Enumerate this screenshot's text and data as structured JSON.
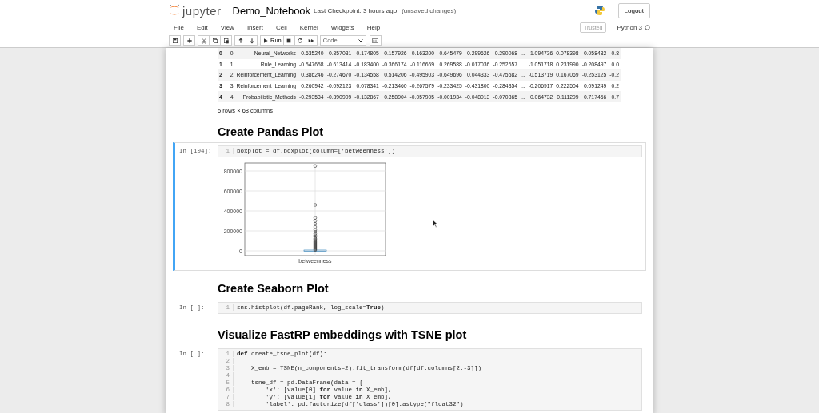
{
  "header": {
    "logo_text": "jupyter",
    "notebook_name": "Demo_Notebook",
    "checkpoint": "Last Checkpoint: 3 hours ago",
    "unsaved": "(unsaved changes)",
    "logout": "Logout"
  },
  "menu": [
    "File",
    "Edit",
    "View",
    "Insert",
    "Cell",
    "Kernel",
    "Widgets",
    "Help"
  ],
  "toolbar": {
    "run_label": "Run",
    "cell_type": "Code",
    "trusted": "Trusted",
    "kernel": "Python 3"
  },
  "cells": [
    {
      "kind": "table",
      "rows": [
        {
          "index": "0",
          "cells": [
            "0",
            "Neural_Networks",
            "-0.635240",
            "0.357031",
            "0.174805",
            "-0.157926",
            "0.163200",
            "-0.645479",
            "0.299626",
            "0.290068",
            "...",
            "1.094736",
            "0.078398",
            "0.058482",
            "-0.8"
          ]
        },
        {
          "index": "1",
          "cells": [
            "1",
            "Rule_Learning",
            "-0.547658",
            "-0.613414",
            "-0.183400",
            "-0.366174",
            "-0.116669",
            "0.269588",
            "-0.017036",
            "-0.252657",
            "...",
            "-1.051718",
            "0.231990",
            "-0.208497",
            "0.0"
          ]
        },
        {
          "index": "2",
          "cells": [
            "2",
            "Reinforcement_Learning",
            "0.386246",
            "-0.274670",
            "-0.134558",
            "0.514206",
            "-0.495903",
            "-0.649696",
            "0.044333",
            "-0.475582",
            "...",
            "-0.513719",
            "0.167069",
            "-0.253125",
            "-0.2"
          ]
        },
        {
          "index": "3",
          "cells": [
            "3",
            "Reinforcement_Learning",
            "0.260942",
            "-0.092123",
            "0.078341",
            "-0.213460",
            "-0.267579",
            "-0.233425",
            "-0.431800",
            "-0.284354",
            "...",
            "-0.206917",
            "0.222504",
            "0.091249",
            "0.2"
          ]
        },
        {
          "index": "4",
          "cells": [
            "4",
            "Probabilistic_Methods",
            "-0.293534",
            "-0.390909",
            "-0.132867",
            "0.258904",
            "-0.057905",
            "-0.001934",
            "-0.048013",
            "-0.070865",
            "...",
            "0.064732",
            "0.111299",
            "0.717456",
            "0.7"
          ]
        }
      ],
      "summary": "5 rows × 68 columns"
    },
    {
      "kind": "heading",
      "text": "Create Pandas Plot"
    },
    {
      "kind": "code",
      "prompt": "In [104]:",
      "selected": true,
      "lines": [
        {
          "number": "1",
          "code": "boxplot = df.boxplot(column=['betweenness'])"
        }
      ],
      "plot": {
        "kind": "boxplot",
        "yticks": [
          "800000",
          "600000",
          "400000",
          "200000",
          "0"
        ],
        "xlabel": "betweenness"
      }
    },
    {
      "kind": "heading",
      "text": "Create Seaborn Plot"
    },
    {
      "kind": "code",
      "prompt": "In [ ]:",
      "selected": false,
      "lines": [
        {
          "number": "1",
          "code": "sns.histplot(df.pageRank, log_scale=**True**)"
        }
      ]
    },
    {
      "kind": "heading",
      "text": "Visualize FastRP embeddings with TSNE plot"
    },
    {
      "kind": "code",
      "prompt": "In [ ]:",
      "selected": false,
      "lines": [
        {
          "number": "1",
          "code": "**def** create_tsne_plot(df):"
        },
        {
          "number": "2"
        },
        {
          "number": "3",
          "code": "    X_emb = TSNE(n_components=2).fit_transform(df[df.columns[2:-3]])"
        },
        {
          "number": "4"
        },
        {
          "number": "5",
          "code": "    tsne_df = pd.DataFrame(data = {"
        },
        {
          "number": "6",
          "code": "        'x': [value[0] **for** value **in** X_emb],"
        },
        {
          "number": "7",
          "code": "        'y': [value[1] **for** value **in** X_emb],"
        },
        {
          "number": "8",
          "code": "        'label': pd.factorize(df['class'])[0].astype(\"float32\")"
        }
      ]
    }
  ]
}
